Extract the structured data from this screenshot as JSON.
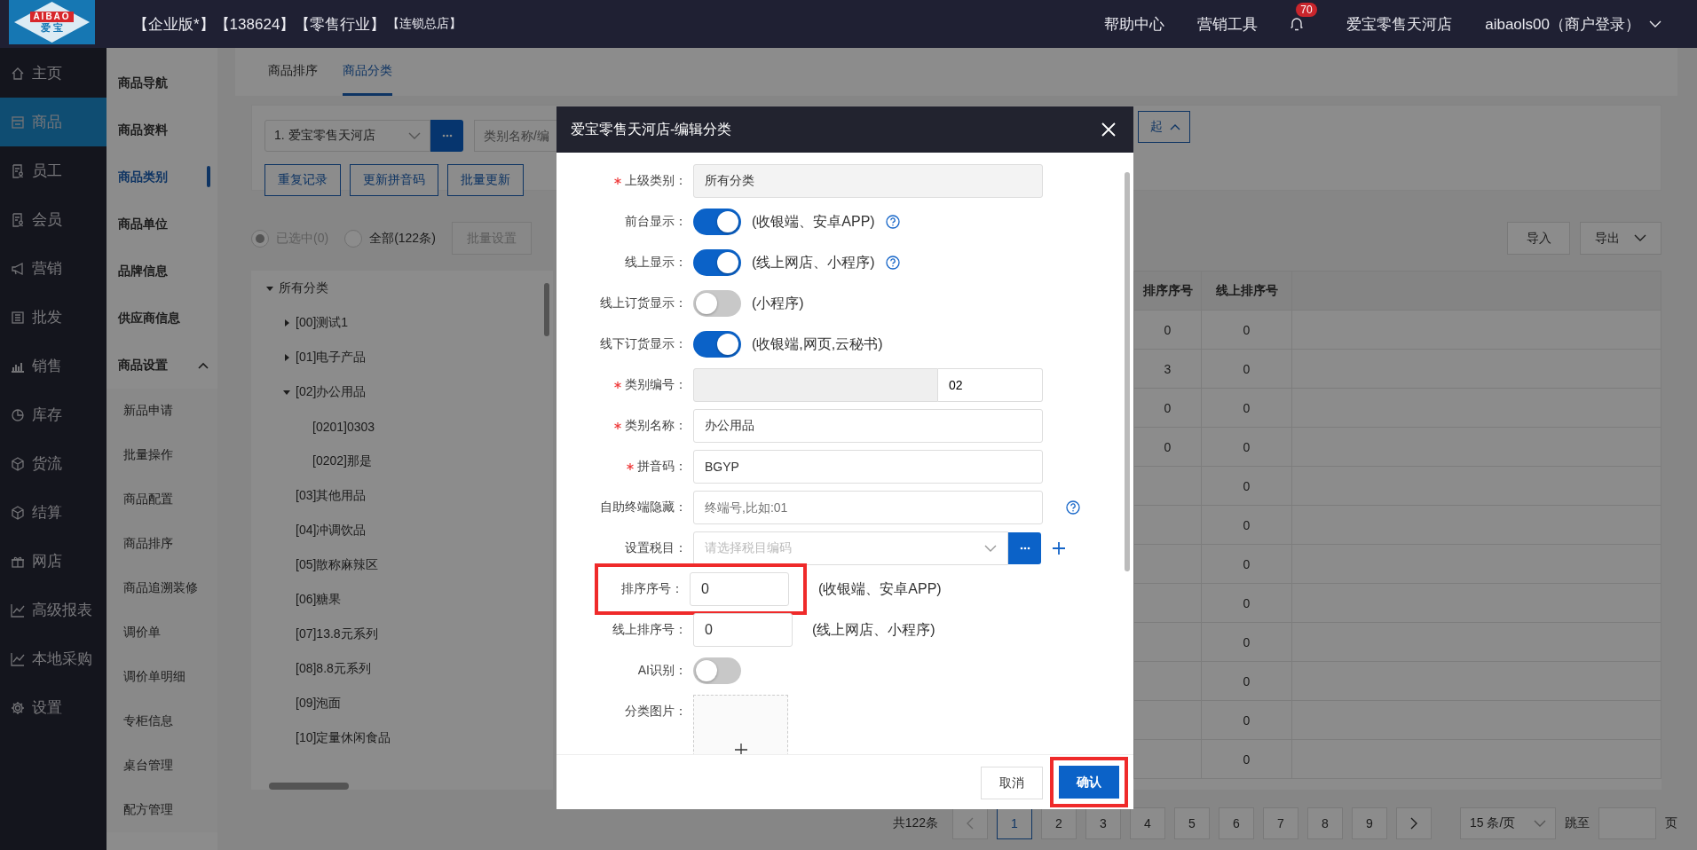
{
  "header": {
    "logo_text": "AIBAO",
    "logo_subtext": "爱 宝",
    "title": "【企业版*】【138624】【零售行业】",
    "title_suffix": "【连锁总店】",
    "links": [
      "帮助中心",
      "营销工具"
    ],
    "notification_count": "70",
    "store": "爱宝零售天河店",
    "user": "aibaols00（商户登录）"
  },
  "nav": [
    {
      "label": "主页",
      "kind": "home",
      "selected": false
    },
    {
      "label": "商品",
      "kind": "store",
      "selected": true
    },
    {
      "label": "员工",
      "kind": "badge",
      "selected": false
    },
    {
      "label": "会员",
      "kind": "badge",
      "selected": false
    },
    {
      "label": "营销",
      "kind": "megaphone",
      "selected": false
    },
    {
      "label": "批发",
      "kind": "list",
      "selected": false
    },
    {
      "label": "销售",
      "kind": "bars",
      "selected": false
    },
    {
      "label": "库存",
      "kind": "pie",
      "selected": false
    },
    {
      "label": "货流",
      "kind": "cube",
      "selected": false
    },
    {
      "label": "结算",
      "kind": "cube",
      "selected": false
    },
    {
      "label": "网店",
      "kind": "gift",
      "selected": false
    },
    {
      "label": "高级报表",
      "kind": "line",
      "selected": false
    },
    {
      "label": "本地采购",
      "kind": "line",
      "selected": false
    },
    {
      "label": "设置",
      "kind": "gear",
      "selected": false
    }
  ],
  "subnav": {
    "items": [
      {
        "label": "商品导航",
        "selected": false
      },
      {
        "label": "商品资料",
        "selected": false
      },
      {
        "label": "商品类别",
        "selected": true
      },
      {
        "label": "商品单位",
        "selected": false
      },
      {
        "label": "品牌信息",
        "selected": false
      },
      {
        "label": "供应商信息",
        "selected": false
      }
    ],
    "group": {
      "label": "商品设置",
      "expanded": true,
      "children": [
        "新品申请",
        "批量操作",
        "商品配置",
        "商品排序",
        "商品追溯装修",
        "调价单",
        "调价单明细",
        "专柜信息",
        "桌台管理",
        "配方管理"
      ]
    }
  },
  "tabs": [
    {
      "label": "商品排序",
      "selected": false
    },
    {
      "label": "商品分类",
      "selected": true
    }
  ],
  "filters": {
    "store_select": "1. 爱宝零售天河店",
    "search_placeholder": "类别名称/编",
    "buttons": [
      "重复记录",
      "更新拼音码",
      "批量更新"
    ],
    "collapse_button": "起"
  },
  "selection": {
    "options": [
      {
        "label": "已选中(0)",
        "selected": true,
        "disabled": true
      },
      {
        "label": "全部(122条)",
        "selected": false,
        "disabled": false
      }
    ],
    "batch_button": {
      "label": "批量设置",
      "disabled": true
    },
    "import_button": "导入",
    "export_button": "导出"
  },
  "tree": {
    "label": "所有分类",
    "expanded": true,
    "children": [
      {
        "label": "[00]测试1",
        "expanded": false
      },
      {
        "label": "[01]电子产品",
        "expanded": false
      },
      {
        "label": "[02]办公用品",
        "expanded": true,
        "children": [
          {
            "label": "[0201]0303"
          },
          {
            "label": "[0202]那是"
          }
        ]
      },
      {
        "label": "[03]其他用品"
      },
      {
        "label": "[04]冲调饮品"
      },
      {
        "label": "[05]散称麻辣区"
      },
      {
        "label": "[06]糖果"
      },
      {
        "label": "[07]13.8元系列"
      },
      {
        "label": "[08]8.8元系列"
      },
      {
        "label": "[09]泡面"
      },
      {
        "label": "[10]定量休闲食品"
      }
    ]
  },
  "table": {
    "columns": [
      "排序序号",
      "线上排序号"
    ],
    "rows": [
      {
        "sort_no": "0",
        "online_sort_no": "0"
      },
      {
        "sort_no": "3",
        "online_sort_no": "0"
      },
      {
        "sort_no": "0",
        "online_sort_no": "0"
      },
      {
        "sort_no": "0",
        "online_sort_no": "0"
      },
      {
        "online_sort_no": "0"
      },
      {
        "online_sort_no": "0"
      },
      {
        "online_sort_no": "0"
      },
      {
        "online_sort_no": "0"
      },
      {
        "online_sort_no": "0"
      },
      {
        "online_sort_no": "0"
      },
      {
        "online_sort_no": "0"
      },
      {
        "online_sort_no": "0"
      }
    ]
  },
  "pagination": {
    "total": "共122条",
    "pages": [
      {
        "label": "1",
        "selected": true
      },
      {
        "label": "2",
        "selected": false
      },
      {
        "label": "3",
        "selected": false
      },
      {
        "label": "4",
        "selected": false
      },
      {
        "label": "5",
        "selected": false
      },
      {
        "label": "6",
        "selected": false
      },
      {
        "label": "7",
        "selected": false
      },
      {
        "label": "8",
        "selected": false
      },
      {
        "label": "9",
        "selected": false
      }
    ],
    "page_size": "15 条/页",
    "jump_label": "跳至",
    "page_suffix": "页"
  },
  "dialog": {
    "title": "爱宝零售天河店-编辑分类",
    "fields": [
      {
        "label": "上级类别：",
        "kind": "text",
        "required": true,
        "disabled": true,
        "help": false,
        "highlighted": false,
        "value": "所有分类"
      },
      {
        "label": "前台显示：",
        "kind": "toggle",
        "required": false,
        "disabled": false,
        "help": true,
        "highlighted": false,
        "on": true,
        "note": "(收银端、安卓APP)"
      },
      {
        "label": "线上显示：",
        "kind": "toggle",
        "required": false,
        "disabled": false,
        "help": true,
        "highlighted": false,
        "on": true,
        "note": "(线上网店、小程序)"
      },
      {
        "label": "线上订货显示：",
        "kind": "toggle",
        "required": false,
        "disabled": false,
        "help": false,
        "highlighted": false,
        "on": false,
        "note": "(小程序)"
      },
      {
        "label": "线下订货显示：",
        "kind": "toggle",
        "required": false,
        "disabled": false,
        "help": false,
        "highlighted": false,
        "on": true,
        "note": "(收银端,网页,云秘书)"
      },
      {
        "label": "类别编号：",
        "kind": "code",
        "required": true,
        "disabled": false,
        "help": false,
        "highlighted": false,
        "value": "02"
      },
      {
        "label": "类别名称：",
        "kind": "text",
        "required": true,
        "disabled": false,
        "help": false,
        "highlighted": false,
        "value": "办公用品"
      },
      {
        "label": "拼音码：",
        "kind": "text",
        "required": true,
        "disabled": false,
        "help": false,
        "highlighted": false,
        "value": "BGYP"
      },
      {
        "label": "自助终端隐藏：",
        "kind": "text",
        "required": false,
        "disabled": false,
        "help": true,
        "highlighted": false,
        "placeholder": "终端号,比如:01"
      },
      {
        "label": "设置税目：",
        "kind": "select",
        "required": false,
        "disabled": false,
        "help": false,
        "highlighted": false,
        "placeholder": "请选择税目编码"
      },
      {
        "label": "排序序号：",
        "kind": "number",
        "required": false,
        "disabled": false,
        "help": false,
        "highlighted": true,
        "value": "0",
        "note": "(收银端、安卓APP)"
      },
      {
        "label": "线上排序号：",
        "kind": "number",
        "required": false,
        "disabled": false,
        "help": false,
        "highlighted": false,
        "value": "0",
        "note": "(线上网店、小程序)"
      },
      {
        "label": "AI识别：",
        "kind": "toggle",
        "required": false,
        "disabled": false,
        "help": false,
        "highlighted": false,
        "on": false
      },
      {
        "label": "分类图片：",
        "kind": "upload",
        "required": false,
        "disabled": false,
        "help": false,
        "highlighted": false
      }
    ],
    "buttons": [
      {
        "label": "取消",
        "kind": "secondary",
        "highlighted": false
      },
      {
        "label": "确认",
        "kind": "primary",
        "highlighted": true
      }
    ]
  }
}
